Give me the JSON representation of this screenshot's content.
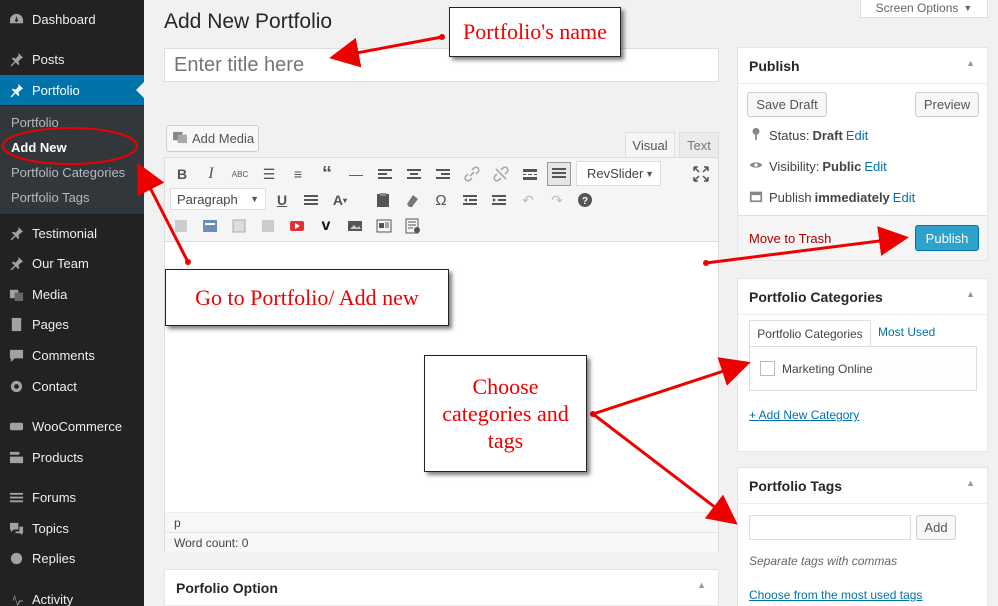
{
  "sidebar": {
    "items": [
      {
        "label": "Dashboard",
        "icon": "dashboard-icon"
      },
      {
        "label": "Posts",
        "icon": "pin-icon"
      },
      {
        "label": "Portfolio",
        "icon": "pin-icon"
      },
      {
        "label": "Testimonial",
        "icon": "pin-icon"
      },
      {
        "label": "Our Team",
        "icon": "pin-icon"
      },
      {
        "label": "Media",
        "icon": "media-icon"
      },
      {
        "label": "Pages",
        "icon": "pages-icon"
      },
      {
        "label": "Comments",
        "icon": "comments-icon"
      },
      {
        "label": "Contact",
        "icon": "gear-icon"
      },
      {
        "label": "WooCommerce",
        "icon": "woo-icon"
      },
      {
        "label": "Products",
        "icon": "products-icon"
      },
      {
        "label": "Forums",
        "icon": "forums-icon"
      },
      {
        "label": "Topics",
        "icon": "topics-icon"
      },
      {
        "label": "Replies",
        "icon": "replies-icon"
      },
      {
        "label": "Activity",
        "icon": "activity-icon"
      }
    ],
    "submenu": [
      "Portfolio",
      "Add New",
      "Portfolio Categories",
      "Portfolio Tags"
    ]
  },
  "header": {
    "title": "Add New Portfolio",
    "screen_options": "Screen Options",
    "title_placeholder": "Enter title here"
  },
  "editor": {
    "add_media": "Add Media",
    "tab_visual": "Visual",
    "tab_text": "Text",
    "revslider": "RevSlider",
    "format_select": "Paragraph",
    "path": "p",
    "word_count": "Word count: 0"
  },
  "portfolio_option": {
    "title": "Porfolio Option"
  },
  "publish": {
    "title": "Publish",
    "save_draft": "Save Draft",
    "preview": "Preview",
    "status_label": "Status:",
    "status_value": "Draft",
    "visibility_label": "Visibility:",
    "visibility_value": "Public",
    "publish_label": "Publish",
    "publish_value": "immediately",
    "edit": "Edit",
    "move_to_trash": "Move to Trash",
    "publish_button": "Publish"
  },
  "categories": {
    "title": "Portfolio Categories",
    "tab_all": "Portfolio Categories",
    "tab_most_used": "Most Used",
    "items": [
      "Marketing Online"
    ],
    "add_new": "+ Add New Category"
  },
  "tags": {
    "title": "Portfolio Tags",
    "add": "Add",
    "hint": "Separate tags with commas",
    "choose": "Choose from the most used tags"
  },
  "annotations": {
    "name": "Portfolio's name",
    "goto": "Go to Portfolio/ Add new",
    "choose": "Choose categories and tags"
  },
  "colors": {
    "sidebar_bg": "#222222",
    "active_bg": "#0073aa",
    "annotation_red": "#e00000",
    "publish_btn": "#2ea2cc"
  }
}
